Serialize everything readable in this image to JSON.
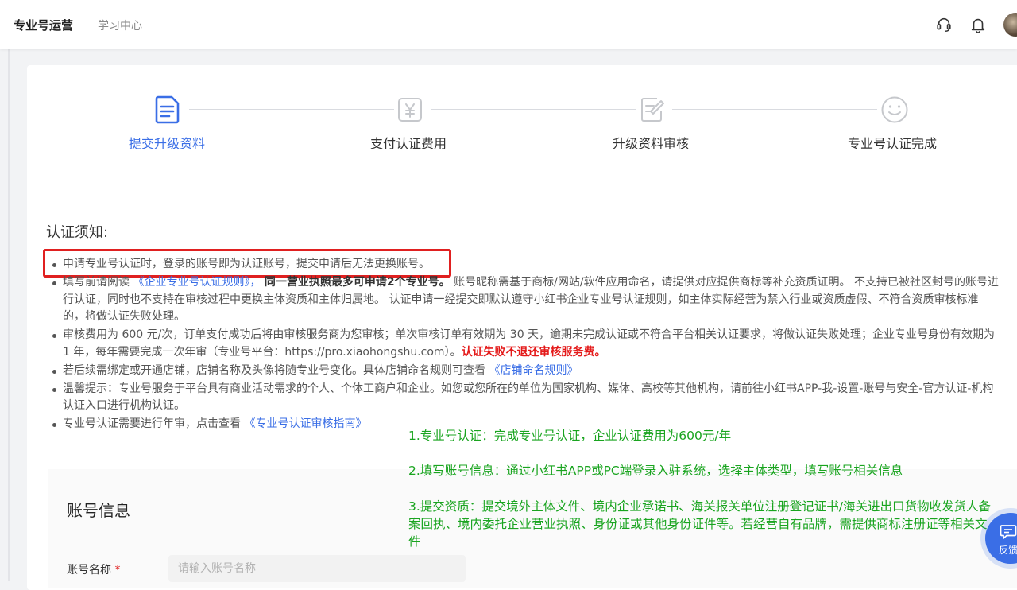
{
  "header": {
    "brand": "专业号运营",
    "nav_learning": "学习中心",
    "icons": [
      "headset-icon",
      "bell-icon",
      "avatar"
    ]
  },
  "steps": [
    {
      "label": "提交升级资料",
      "icon": "document-icon",
      "active": true
    },
    {
      "label": "支付认证费用",
      "icon": "yuan-icon",
      "active": false
    },
    {
      "label": "升级资料审核",
      "icon": "edit-doc-icon",
      "active": false
    },
    {
      "label": "专业号认证完成",
      "icon": "smile-icon",
      "active": false
    }
  ],
  "notice": {
    "title": "认证须知:",
    "b1": "申请专业号认证时，登录的账号即为认证账号，提交申请后无法更换账号。",
    "b2_prefix": "填写前请阅读",
    "b2_link": "《企业专业号认证规则》，",
    "b2_bold": "同一营业执照最多可申请2个专业号。",
    "b2_rest": "账号昵称需基于商标/网站/软件应用命名，请提供对应提供商标等补充资质证明。 不支持已被社区封号的账号进行认证，同时也不支持在审核过程中更换主体资质和主体归属地。 认证申请一经提交即默认遵守小红书企业专业号认证规则，如主体实际经营为禁入行业或资质虚假、不符合资质审核标准的，将做认证失败处理。",
    "b3_text": "审核费用为 600 元/次，订单支付成功后将由审核服务商为您审核；单次审核订单有效期为 30 天，逾期未完成认证或不符合平台相关认证要求，将做认证失败处理；企业专业号身份有效期为 1 年，每年需要完成一次年审（专业号平台：https://pro.xiaohongshu.com）。",
    "b3_red": "认证失败不退还审核服务费。",
    "b4_text": "若后续需绑定或开通店铺，店铺名称及头像将随专业号变化。具体店铺命名规则可查看",
    "b4_link": "《店铺命名规则》",
    "b5_text": "温馨提示：专业号服务于平台具有商业活动需求的个人、个体工商户和企业。如您或您所在的单位为国家机构、媒体、高校等其他机构，请前往小红书APP-我-设置-账号与安全-官方认证-机构认证入口进行机构认证。",
    "b6_text": "专业号认证需要进行年审，点击查看",
    "b6_link": "《专业号认证审核指南》"
  },
  "annotations": {
    "a1": "1.专业号认证：完成专业号认证，企业认证费用为600元/年",
    "a2": "2.填写账号信息：通过小红书APP或PC端登录入驻系统，选择主体类型，填写账号相关信息",
    "a3": "3.提交资质：提交境外主体文件、境内企业承诺书、海关报关单位注册登记证书/海关进出口货物收发货人备案回执、境内委托企业营业执照、身份证或其他身份证件等。若经营自有品牌，需提供商标注册证等相关文件"
  },
  "account_section": {
    "title": "账号信息",
    "name_label": "账号名称",
    "required_mark": "*",
    "name_placeholder": "请输入账号名称"
  },
  "feedback": {
    "label": "反馈"
  },
  "colors": {
    "accent": "#3a6ee6",
    "annotation_green": "#19a41f",
    "alert_red": "#e41919"
  }
}
